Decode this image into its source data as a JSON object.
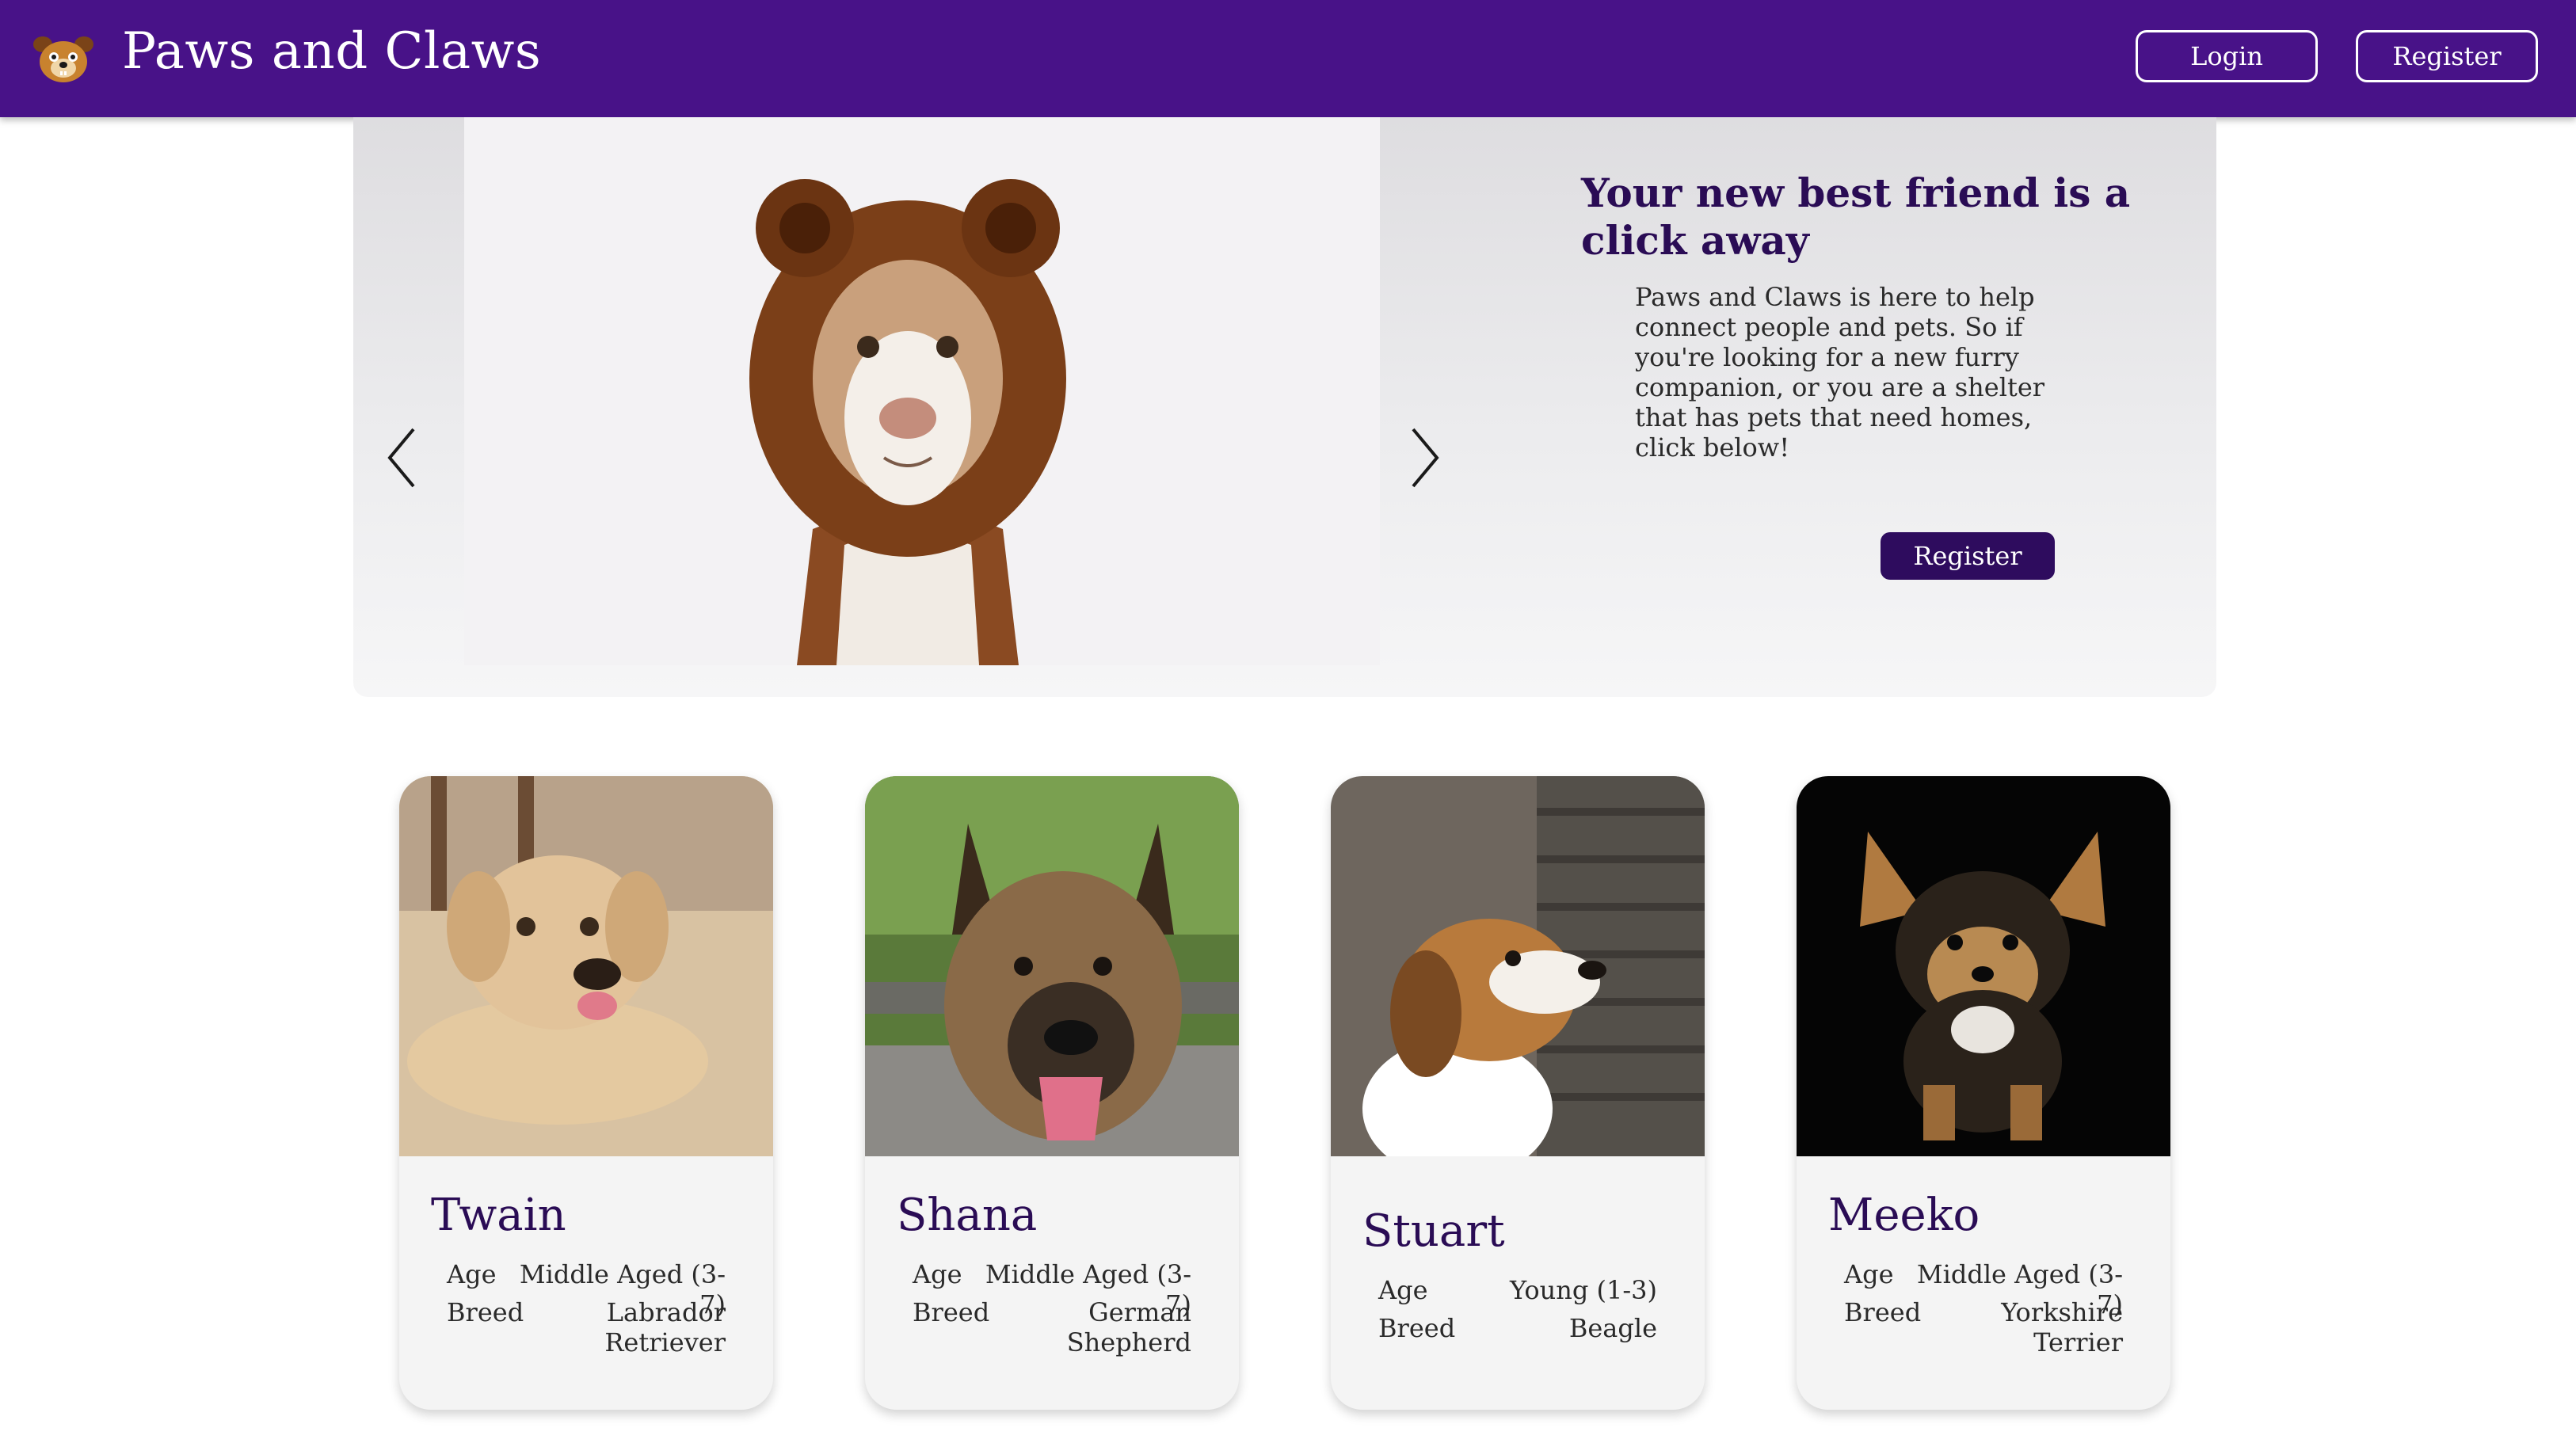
{
  "header": {
    "brand": "Paws and Claws",
    "login_label": "Login",
    "register_label": "Register"
  },
  "hero": {
    "title": "Your new best friend is a click away",
    "body": "Paws and Claws is here to help connect people and pets. So if you're looking for a new furry companion, or you are a shelter that has pets that need homes, click below!",
    "register_label": "Register"
  },
  "pets": [
    {
      "name": "Twain",
      "age_label": "Age",
      "age": "Middle Aged (3-7)",
      "breed_label": "Breed",
      "breed": "Labrador Retriever"
    },
    {
      "name": "Shana",
      "age_label": "Age",
      "age": "Middle Aged (3-7)",
      "breed_label": "Breed",
      "breed": "German Shepherd"
    },
    {
      "name": "Stuart",
      "age_label": "Age",
      "age": "Young (1-3)",
      "breed_label": "Breed",
      "breed": "Beagle"
    },
    {
      "name": "Meeko",
      "age_label": "Age",
      "age": "Middle Aged (3-7)",
      "breed_label": "Breed",
      "breed": "Yorkshire Terrier"
    }
  ],
  "colors": {
    "header": "#481288",
    "accent": "#2e0c5e",
    "title": "#2a0c55"
  },
  "icons": [
    "dog-logo-icon",
    "chevron-left-icon",
    "chevron-right-icon"
  ]
}
